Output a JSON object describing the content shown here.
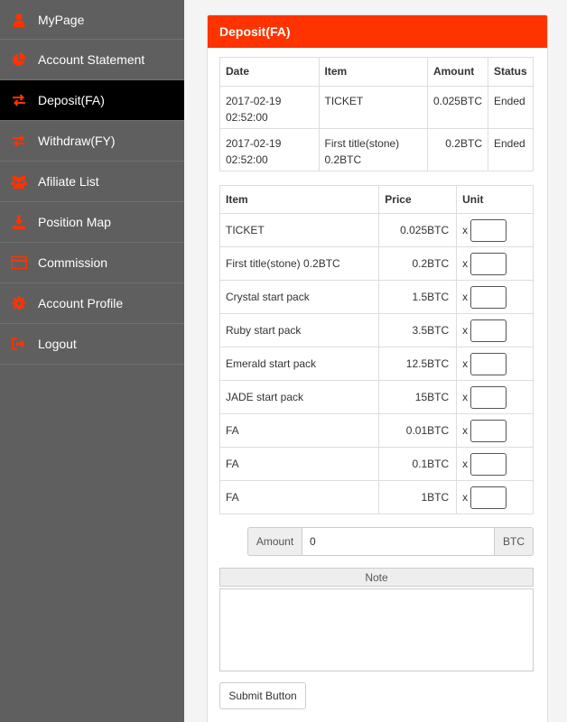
{
  "sidebar": {
    "items": [
      {
        "label": "MyPage",
        "icon": "user-icon"
      },
      {
        "label": "Account Statement",
        "icon": "pie-chart-icon"
      },
      {
        "label": "Deposit(FA)",
        "icon": "exchange-icon",
        "active": true
      },
      {
        "label": "Withdraw(FY)",
        "icon": "exchange-icon"
      },
      {
        "label": "Afiliate List",
        "icon": "users-icon"
      },
      {
        "label": "Position Map",
        "icon": "download-icon"
      },
      {
        "label": "Commission",
        "icon": "credit-card-icon"
      },
      {
        "label": "Account Profile",
        "icon": "gear-icon"
      },
      {
        "label": "Logout",
        "icon": "sign-out-icon"
      }
    ]
  },
  "colors": {
    "accent": "#ff3300",
    "sidebar_bg": "#5f5f5f",
    "active_bg": "#000000"
  },
  "panel": {
    "title": "Deposit(FA)"
  },
  "history": {
    "headers": {
      "date": "Date",
      "item": "Item",
      "amount": "Amount",
      "status": "Status"
    },
    "rows": [
      {
        "date1": "2017-02-19",
        "date2": "02:52:00",
        "item1": "TICKET",
        "item2": "",
        "amount": "0.025BTC",
        "status": "Ended"
      },
      {
        "date1": "2017-02-19",
        "date2": "02:52:00",
        "item1": "First title(stone)",
        "item2": "0.2BTC",
        "amount": "0.2BTC",
        "status": "Ended"
      }
    ]
  },
  "items": {
    "headers": {
      "item": "Item",
      "price": "Price",
      "unit": "Unit"
    },
    "unit_prefix": "x",
    "rows": [
      {
        "item": "TICKET",
        "price": "0.025BTC"
      },
      {
        "item": "First title(stone) 0.2BTC",
        "price": "0.2BTC"
      },
      {
        "item": "Crystal start pack",
        "price": "1.5BTC"
      },
      {
        "item": "Ruby start pack",
        "price": "3.5BTC"
      },
      {
        "item": "Emerald start pack",
        "price": "12.5BTC"
      },
      {
        "item": "JADE start pack",
        "price": "15BTC"
      },
      {
        "item": "FA",
        "price": "0.01BTC"
      },
      {
        "item": "FA",
        "price": "0.1BTC"
      },
      {
        "item": "FA",
        "price": "1BTC"
      }
    ]
  },
  "amount": {
    "label": "Amount",
    "value": "0",
    "unit": "BTC"
  },
  "note": {
    "label": "Note",
    "value": ""
  },
  "submit": {
    "label": "Submit Button"
  }
}
